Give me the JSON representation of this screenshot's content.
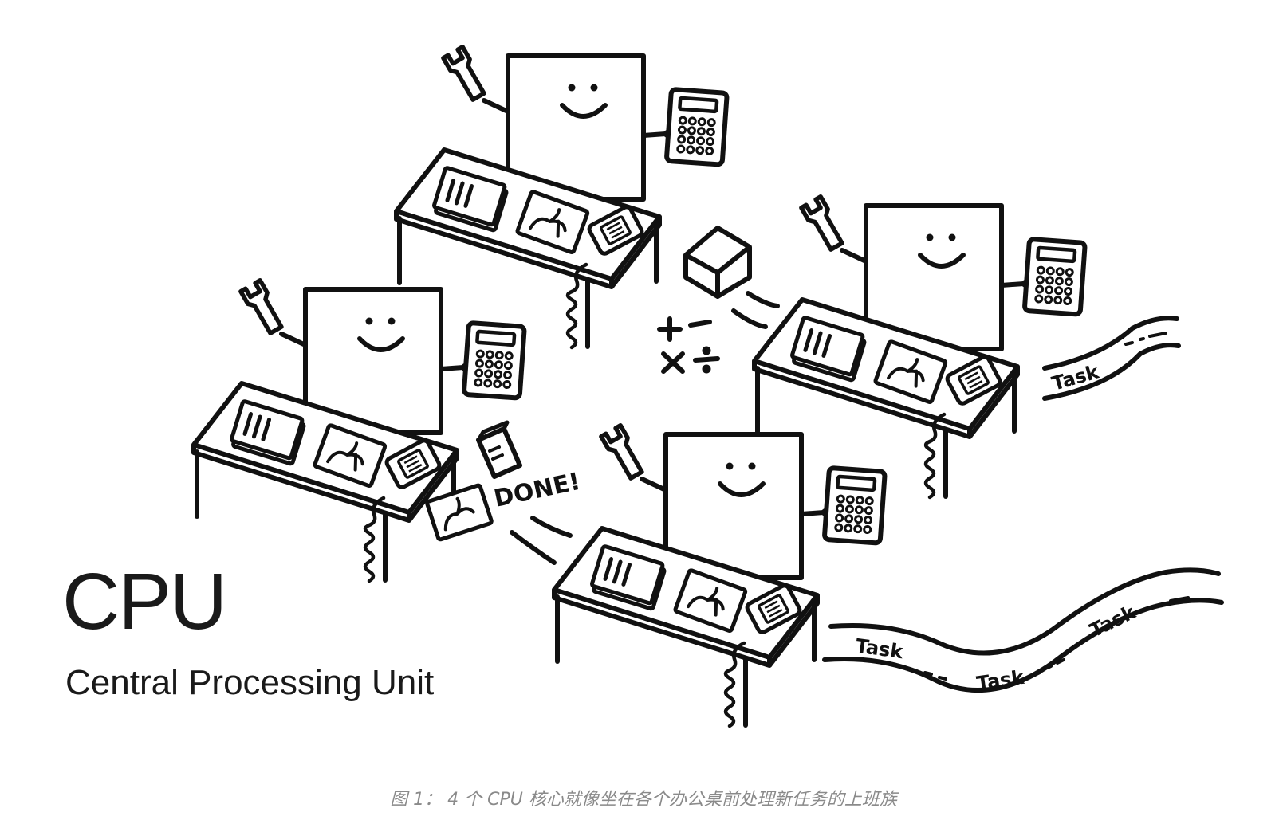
{
  "title": "CPU",
  "subtitle": "Central Processing Unit",
  "caption": "图 1： 4 个 CPU 核心就像坐在各个办公桌前处理新任务的上班族",
  "annotations": {
    "done": "DONE!",
    "task": "Task"
  },
  "icons": [
    "wrench-icon",
    "calculator-icon",
    "telephone-icon",
    "folder-icon",
    "picture-icon",
    "box-icon",
    "book-icon",
    "math-symbols-icon"
  ],
  "colors": {
    "ink": "#111111",
    "caption": "#8a8a8a",
    "background": "#ffffff"
  }
}
